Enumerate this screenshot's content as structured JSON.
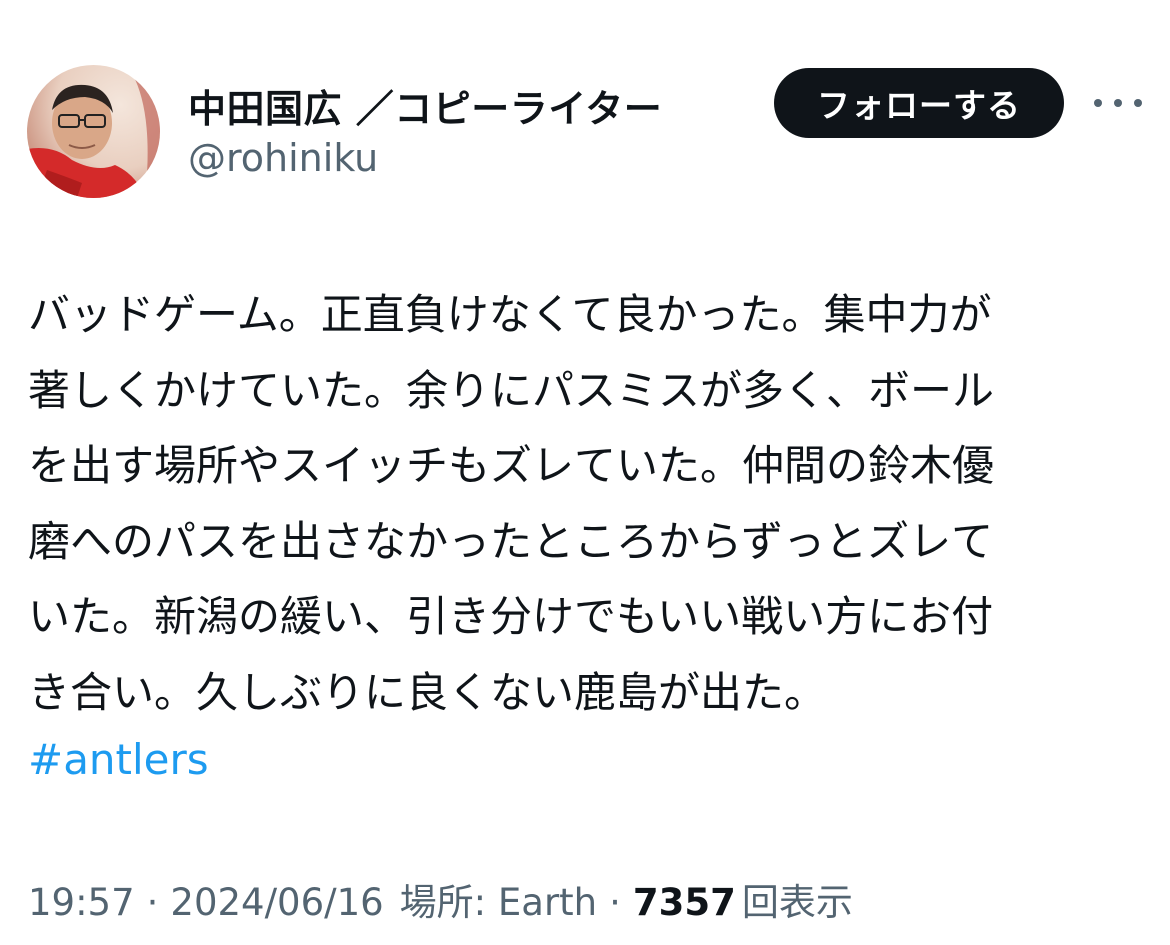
{
  "author": {
    "display_name": "中田国広 ／コピーライター",
    "handle": "@rohiniku"
  },
  "actions": {
    "follow_label": "フォローする",
    "more_icon": "more-horizontal-icon"
  },
  "tweet": {
    "lines": [
      "バッドゲーム。正直負けなくて良かった。集中力が",
      "著しくかけていた。余りにパスミスが多く、ボール",
      "を出す場所やスイッチもズレていた。仲間の鈴木優",
      "磨へのパスを出さなかったところからずっとズレて",
      "いた。新潟の緩い、引き分けでもいい戦い方にお付",
      "き合い。久しぶりに良くない鹿島が出た。"
    ],
    "hashtag": "#antlers"
  },
  "meta": {
    "time": "19:57",
    "separator": "·",
    "date": "2024/06/16",
    "location": "場所: Earth",
    "views": "7357",
    "views_label": "回表示"
  },
  "colors": {
    "text": "#0f1419",
    "secondary": "#536471",
    "link": "#1d9bf0",
    "follow_bg": "#0f1419"
  }
}
